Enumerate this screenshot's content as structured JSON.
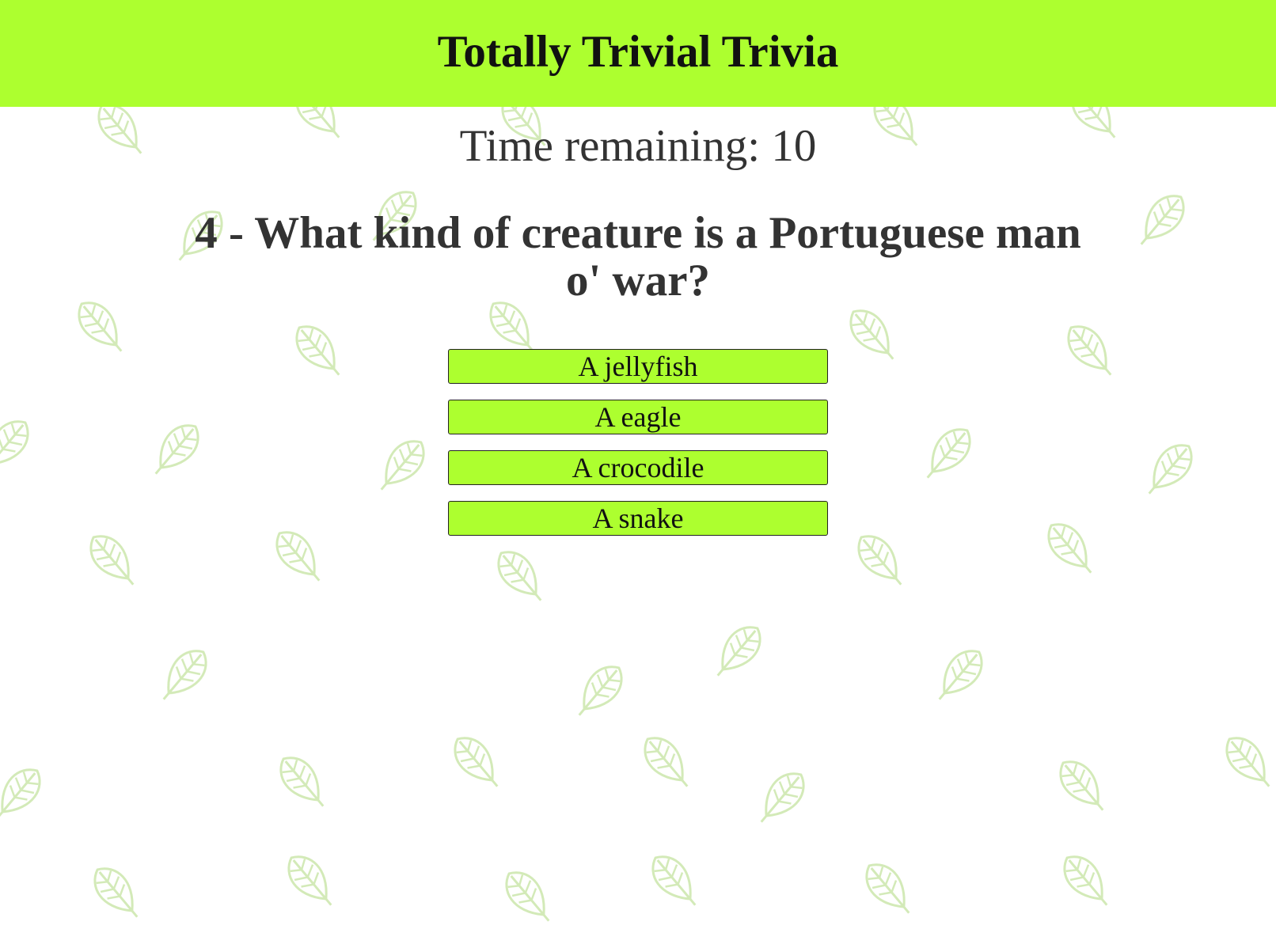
{
  "header": {
    "title": "Totally Trivial Trivia",
    "background_color": "#adff2f"
  },
  "timer": {
    "text": "Time remaining: 10"
  },
  "question": {
    "text": "4 - What kind of creature is a Portuguese man o' war?"
  },
  "answers": [
    {
      "label": "A jellyfish"
    },
    {
      "label": "A eagle"
    },
    {
      "label": "A crocodile"
    },
    {
      "label": "A snake"
    }
  ],
  "background": {
    "pattern_icon": "leaf-icon",
    "pattern_color": "#cfe8b0"
  }
}
